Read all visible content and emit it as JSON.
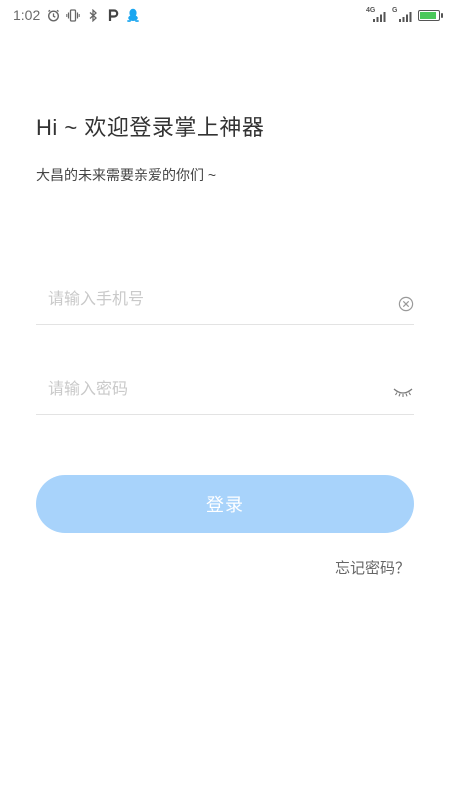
{
  "status_bar": {
    "time": "1:02",
    "left_icons": [
      "alarm-icon",
      "vibrate-icon",
      "bluetooth-icon",
      "p-app-icon",
      "qq-icon"
    ],
    "network_1": "4G",
    "network_2": "G",
    "battery_level": 0.9,
    "battery_color": "#4bc85a"
  },
  "login": {
    "greeting": "Hi ~ 欢迎登录掌上神器",
    "subtitle": "大昌的未来需要亲爱的你们 ~",
    "phone_placeholder": "请输入手机号",
    "phone_value": "",
    "password_placeholder": "请输入密码",
    "password_value": "",
    "login_label": "登录",
    "forgot_label": "忘记密码？",
    "colors": {
      "button_bg": "#a8d3fb",
      "button_text": "#ffffff",
      "placeholder": "#c9c9c9"
    }
  }
}
